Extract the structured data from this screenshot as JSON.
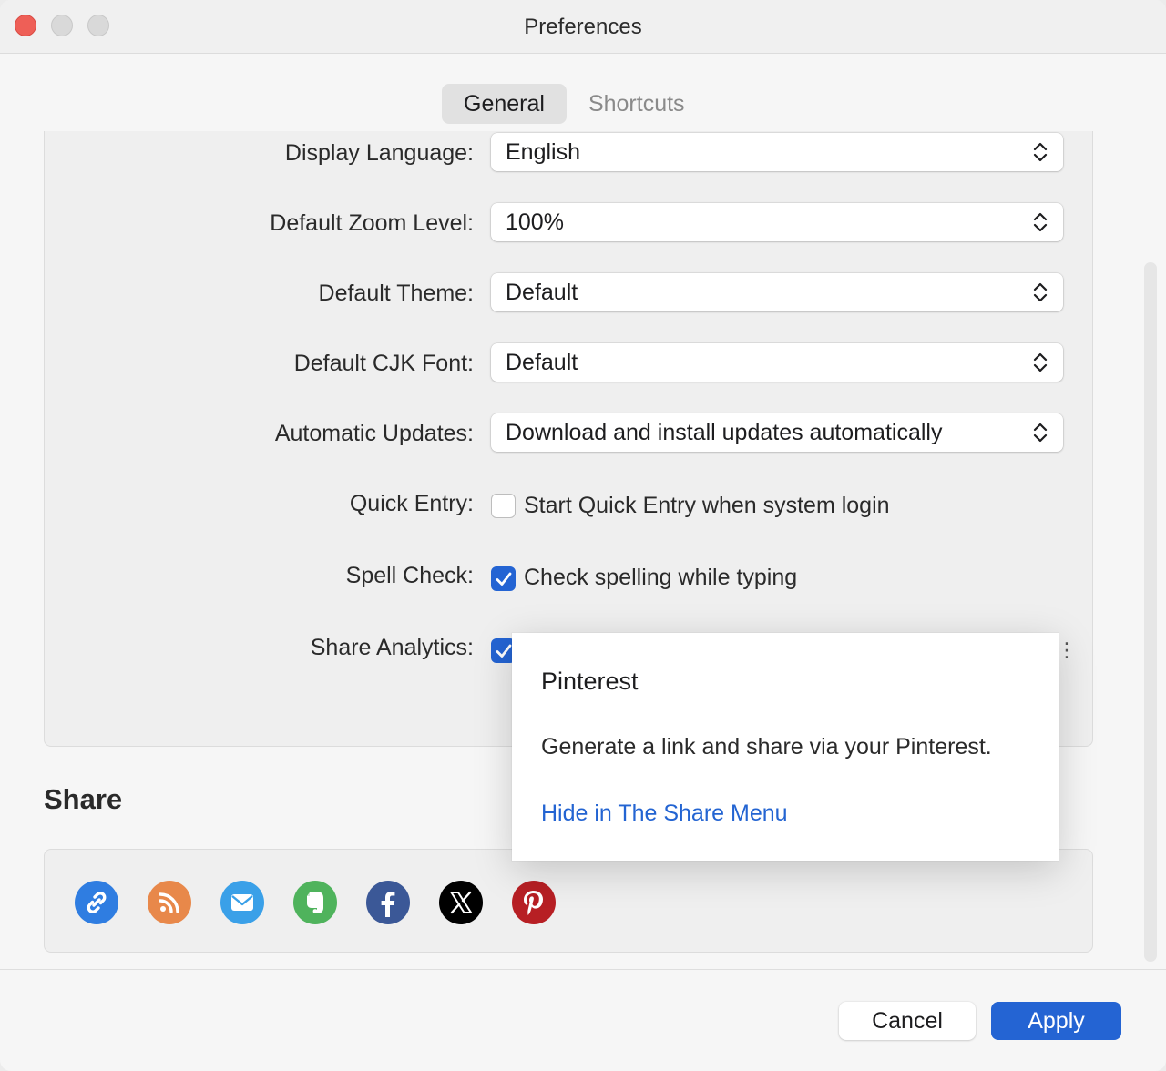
{
  "window": {
    "title": "Preferences"
  },
  "tabs": [
    {
      "label": "General",
      "active": true
    },
    {
      "label": "Shortcuts",
      "active": false
    }
  ],
  "general": {
    "display_language": {
      "label": "Display Language:",
      "value": "English"
    },
    "default_zoom": {
      "label": "Default Zoom Level:",
      "value": "100%"
    },
    "default_theme": {
      "label": "Default Theme:",
      "value": "Default"
    },
    "default_cjk_font": {
      "label": "Default CJK Font:",
      "value": "Default"
    },
    "automatic_updates": {
      "label": "Automatic Updates:",
      "value": "Download and install updates automatically"
    },
    "quick_entry": {
      "label": "Quick Entry:",
      "text": "Start Quick Entry when system login",
      "checked": false
    },
    "spell_check": {
      "label": "Spell Check:",
      "text": "Check spelling while typing",
      "checked": true
    },
    "share_analytics": {
      "label": "Share Analytics:",
      "checked": true
    }
  },
  "share": {
    "heading": "Share",
    "icons": [
      {
        "name": "link-icon",
        "color": "#2f7de1"
      },
      {
        "name": "rss-icon",
        "color": "#e8884a"
      },
      {
        "name": "email-icon",
        "color": "#3aa0e8"
      },
      {
        "name": "evernote-icon",
        "color": "#4fb35c"
      },
      {
        "name": "facebook-icon",
        "color": "#3b5897"
      },
      {
        "name": "x-icon",
        "color": "#000000"
      },
      {
        "name": "pinterest-icon",
        "color": "#b71f24"
      }
    ]
  },
  "popover": {
    "title": "Pinterest",
    "description": "Generate a link and share via your Pinterest.",
    "link": "Hide in The Share Menu"
  },
  "footer": {
    "cancel_label": "Cancel",
    "apply_label": "Apply"
  },
  "colors": {
    "accent": "#2464d3",
    "link": "#2364d2"
  }
}
